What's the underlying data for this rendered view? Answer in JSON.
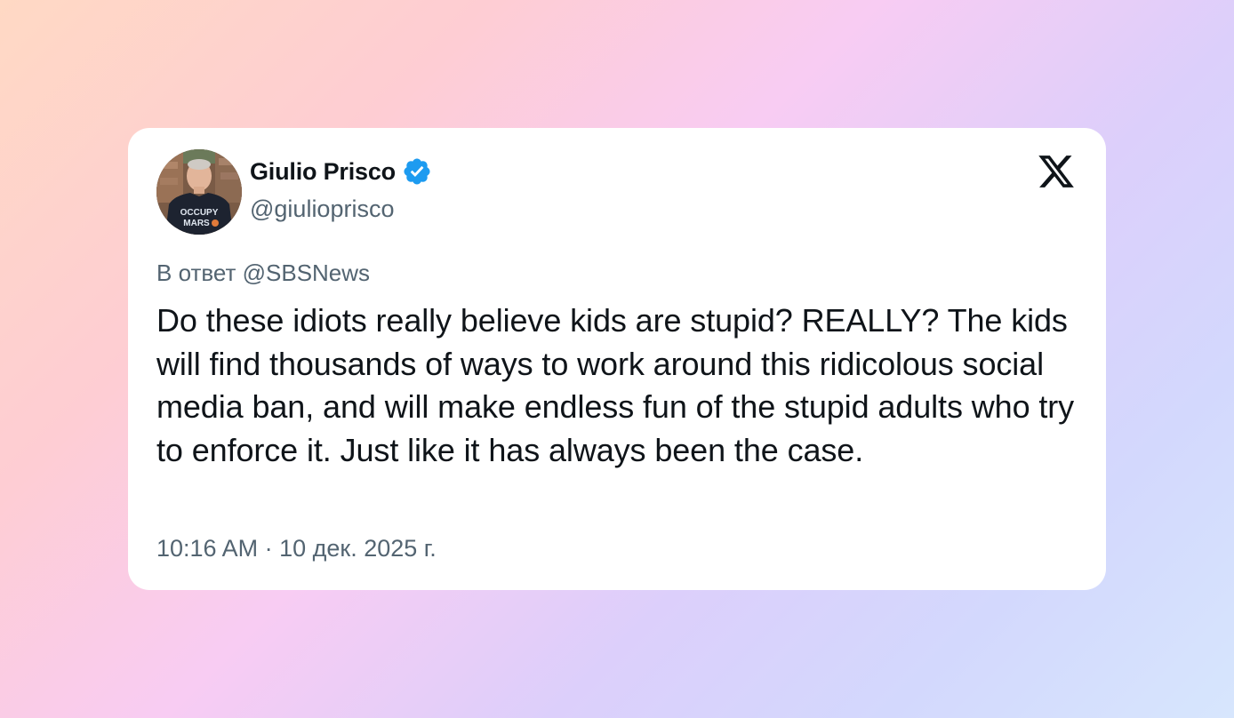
{
  "author": {
    "display_name": "Giulio Prisco",
    "handle": "@giulioprisco",
    "verified": true,
    "avatar_shirt_text_line1": "OCCUPY",
    "avatar_shirt_text_line2": "MARS"
  },
  "platform_icon": "x-logo-icon",
  "reply_to": "В ответ @SBSNews",
  "tweet_text": "Do these idiots really believe kids are stupid? REALLY? The kids will find thousands of ways to work around this ridicolous social media ban, and will make endless fun of the stupid adults who try to enforce it. Just like it has always been the case.",
  "timestamp": "10:16 AM · 10 дек. 2025 г.",
  "colors": {
    "verified_badge": "#1d9bf0",
    "secondary_text": "#536471",
    "primary_text": "#0f1419"
  }
}
